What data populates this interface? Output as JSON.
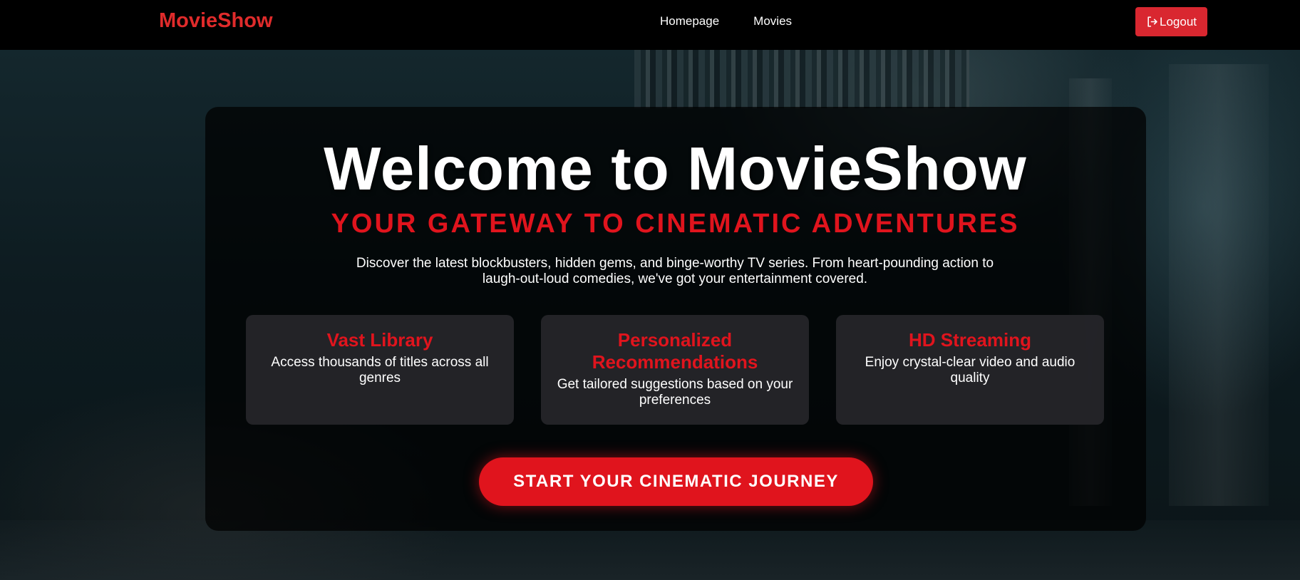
{
  "navbar": {
    "brand": "MovieShow",
    "links": [
      {
        "label": "Homepage"
      },
      {
        "label": "Movies"
      }
    ],
    "logout_label": "Logout",
    "logout_icon": "logout-icon"
  },
  "hero": {
    "title": "Welcome to MovieShow",
    "subtitle": "YOUR GATEWAY TO CINEMATIC ADVENTURES",
    "description": "Discover the latest blockbusters, hidden gems, and binge-worthy TV series. From heart-pounding action to laugh-out-loud comedies, we've got your entertainment covered."
  },
  "features": [
    {
      "title": "Vast Library",
      "text": "Access thousands of titles across all genres"
    },
    {
      "title": "Personalized Recommendations",
      "text": "Get tailored suggestions based on your preferences"
    },
    {
      "title": "HD Streaming",
      "text": "Enjoy crystal-clear video and audio quality"
    }
  ],
  "cta": {
    "label": "START YOUR CINEMATIC JOURNEY"
  },
  "colors": {
    "accent": "#e0141d",
    "brand": "#e02b2b",
    "navbar_bg": "#000000",
    "card_bg": "#26262a"
  }
}
